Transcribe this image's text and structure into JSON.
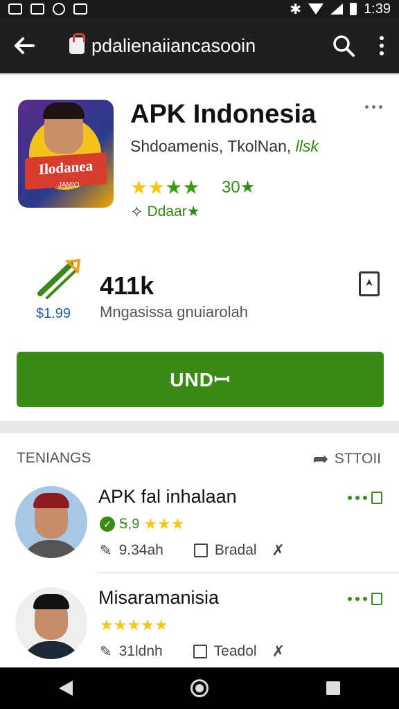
{
  "status": {
    "time": "1:39"
  },
  "toolbar": {
    "url": "pdalienaiiancasooin"
  },
  "app": {
    "icon_text": "Ilodanea",
    "icon_sub": "JAMIO",
    "title": "APK Indonesia",
    "developer": "Shdoamenis, TkolNan,",
    "developer_tag": "llsk",
    "rating_value": "30★",
    "badge_text": "Ddaar★",
    "price": "$1.99",
    "downloads": "411k",
    "downloads_label": "Mngasissa gnuiarolah",
    "install_label": "UNDꟷ"
  },
  "reviews": {
    "header": "TENIANGS",
    "share_label": "STTOII",
    "items": [
      {
        "name": "APK fal inhalaan",
        "score": "Ꭶ,9",
        "date": "9.34ah",
        "action": "Bradal"
      },
      {
        "name": "Misaramanisia",
        "score": "",
        "date": "31ldnh",
        "action": "Teadol"
      }
    ]
  },
  "colors": {
    "accent": "#3a8a17",
    "star": "#f5c518",
    "toolbar": "#1f1f1f"
  },
  "icons": [
    "back-arrow-icon",
    "search-icon",
    "more-vert-icon",
    "bookmark-icon",
    "share-icon",
    "download-icon"
  ]
}
